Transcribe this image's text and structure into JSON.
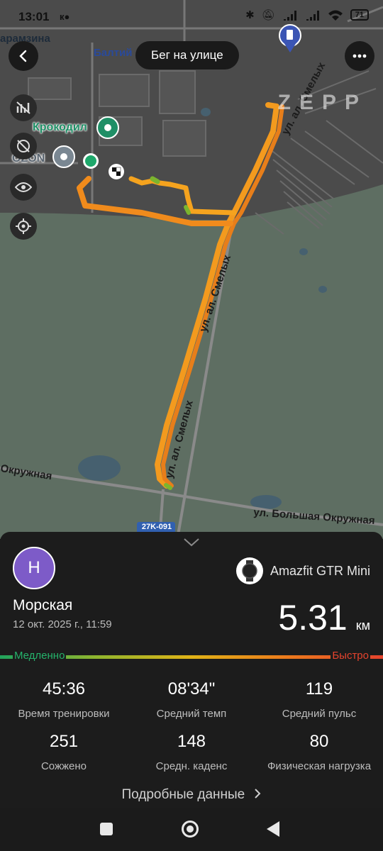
{
  "status_bar": {
    "time": "13:01",
    "carrier_badge": "к●",
    "battery": "71"
  },
  "map": {
    "title": "Бег на улице",
    "brand": "ZEPP",
    "places": {
      "top_left": "арамзина",
      "top_center": "Балтий",
      "poi_1": "Крокодил",
      "poi_2": "OZON"
    },
    "streets": {
      "s1": "ул. ал. Смелых",
      "s2": "ул. ал. Смелых",
      "s3": "ул. ал. Смелых",
      "ring": "Окружная",
      "big_ring": "ул. Большая Окружная",
      "road_badge": "27K-091"
    }
  },
  "workout": {
    "avatar_letter": "Н",
    "device": "Amazfit GTR Mini",
    "location": "Морская",
    "date": "12 окт. 2025 г., 11:59",
    "distance_value": "5.31",
    "distance_unit": "км",
    "pace_slow": "Медленно",
    "pace_fast": "Быстро",
    "stats": [
      {
        "value": "45:36",
        "label": "Время тренировки"
      },
      {
        "value": "08'34\"",
        "label": "Средний темп"
      },
      {
        "value": "119",
        "label": "Средний пульс"
      },
      {
        "value": "251",
        "label": "Сожжено"
      },
      {
        "value": "148",
        "label": "Средн. каденс"
      },
      {
        "value": "80",
        "label": "Физическая нагрузка"
      }
    ],
    "details_link": "Подробные данные"
  },
  "colors": {
    "track": "#f39a1e",
    "accent_green": "#1f8f66",
    "avatar": "#7d5bc8"
  }
}
